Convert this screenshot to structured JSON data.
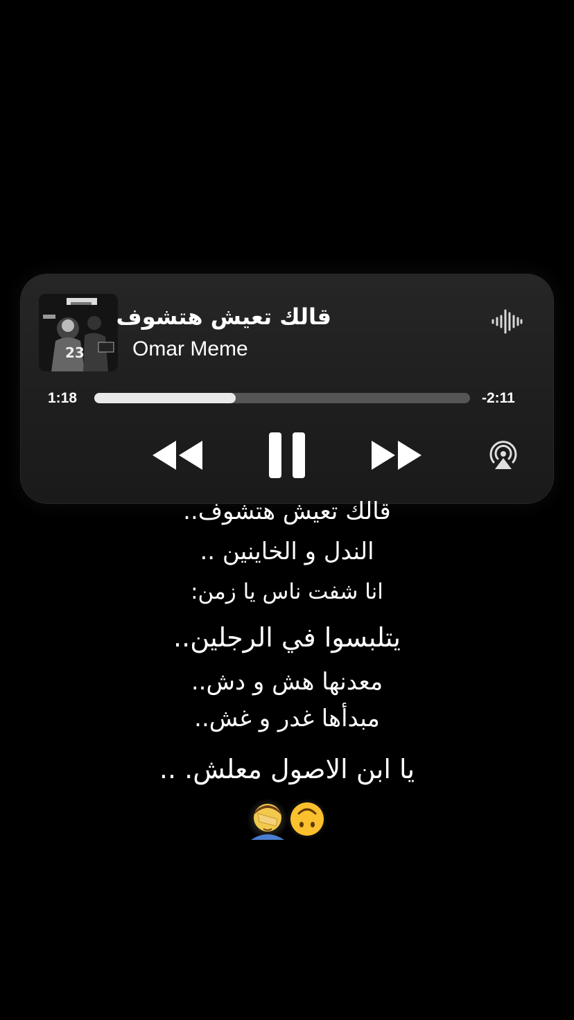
{
  "player": {
    "title": "قالك تعيش هتشوف",
    "artist": "Omar Meme",
    "elapsed": "1:18",
    "remaining": "-2:11",
    "progress": 0.377,
    "accent": "#ffffff",
    "icons": {
      "album": "album-art",
      "visualizer": "waveform-icon",
      "previous": "rewind-icon",
      "play_state": "pause-icon",
      "next": "fast-forward-icon",
      "airplay": "airplay-icon"
    }
  },
  "lyrics": [
    "قالك تعيش هتشوف..",
    "الندل و الخاينين ..",
    "انا شفت ناس يا زمن:",
    "يتلبسوا في الرجلين..",
    "معدنها هش و دش..",
    "مبدأها غدر و غش..",
    "يا ابن الاصول معلش. .."
  ],
  "emojis": [
    "upside-down-face-emoji",
    "face-palm-emoji"
  ]
}
